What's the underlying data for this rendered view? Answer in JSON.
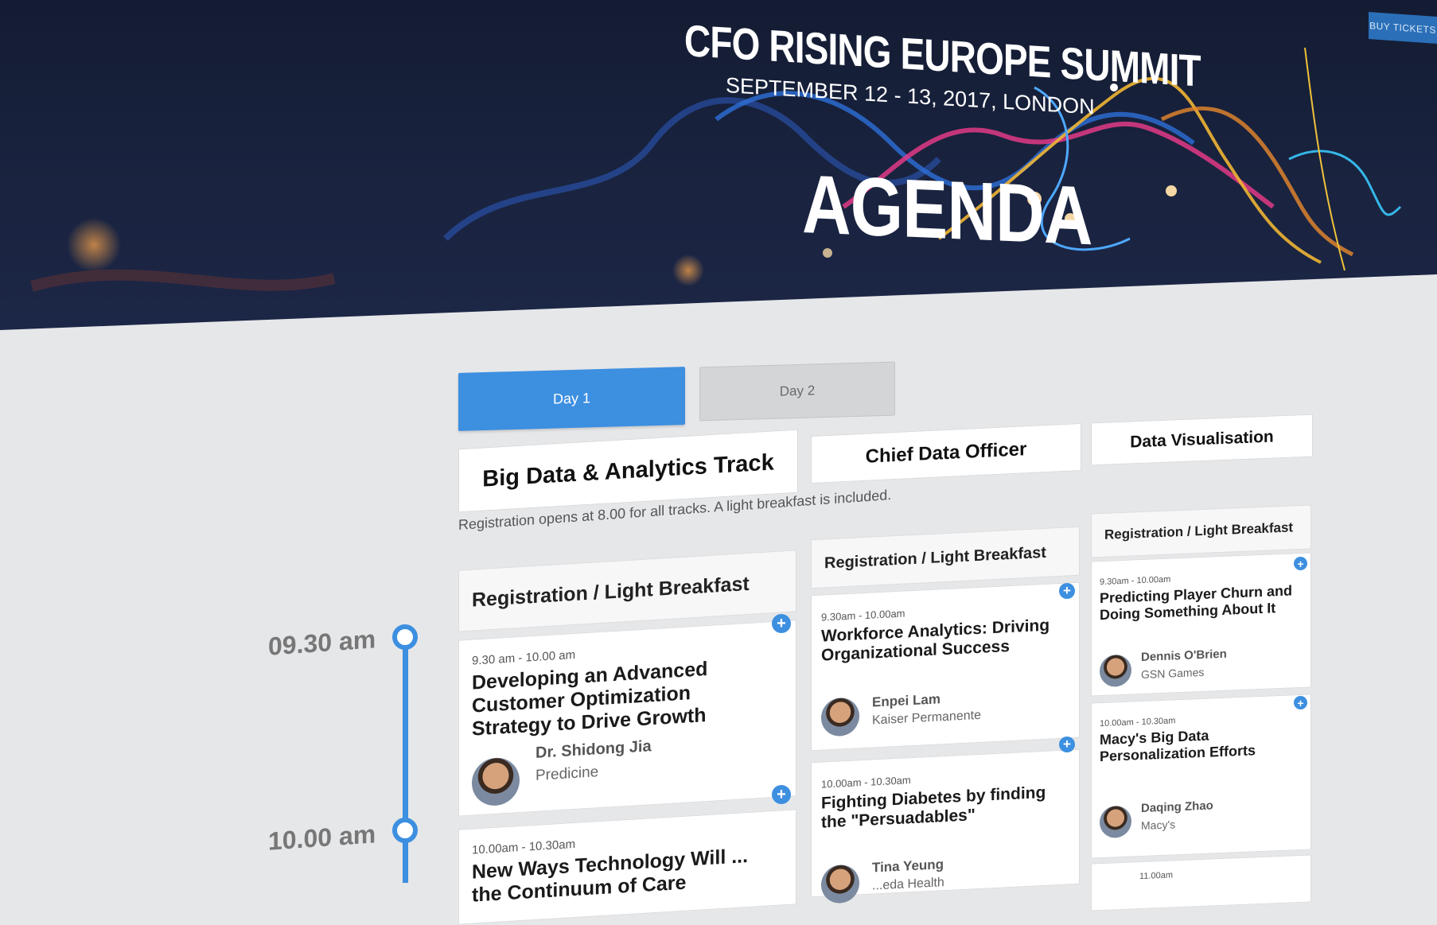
{
  "header": {
    "buy_tickets": "BUY TICKETS",
    "event_title": "CFO RISING EUROPE SUMMIT",
    "event_subtitle": "SEPTEMBER 12 - 13, 2017, LONDON",
    "page_title": "AGENDA"
  },
  "tabs": [
    {
      "label": "Day 1",
      "active": true
    },
    {
      "label": "Day 2",
      "active": false
    }
  ],
  "tracks": [
    {
      "name": "Big Data & Analytics Track"
    },
    {
      "name": "Chief Data Officer"
    },
    {
      "name": "Data Visualisation"
    }
  ],
  "note": "Registration opens at 8.00 for all tracks. A light breakfast is included.",
  "registration_label": "Registration / Light Breakfast",
  "timeline": [
    "09.30 am",
    "10.00 am"
  ],
  "sessions": {
    "col1": [
      {
        "time": "9.30 am - 10.00 am",
        "title": "Developing an Advanced Customer Optimization Strategy to Drive Growth",
        "speaker": "Dr. Shidong Jia",
        "org": "Predicine"
      },
      {
        "time": "10.00am - 10.30am",
        "title": "New Ways Technology Will ... the Continuum of Care"
      }
    ],
    "col2": [
      {
        "time": "9.30am - 10.00am",
        "title": "Workforce Analytics: Driving Organizational Success",
        "speaker": "Enpei Lam",
        "org": "Kaiser Permanente"
      },
      {
        "time": "10.00am - 10.30am",
        "title": "Fighting Diabetes by finding the \"Persuadables\"",
        "speaker": "Tina Yeung",
        "org": "...eda Health"
      }
    ],
    "col3": [
      {
        "time": "9.30am - 10.00am",
        "title": "Predicting Player Churn and Doing Something About It",
        "speaker": "Dennis O'Brien",
        "org": "GSN Games"
      },
      {
        "time": "10.00am - 10.30am",
        "title": "Macy's Big Data Personalization Efforts",
        "speaker": "Daqing Zhao",
        "org": "Macy's"
      },
      {
        "time": "11.00am"
      }
    ]
  },
  "colors": {
    "accent": "#3d8fe0",
    "hero_bg": "#141c33"
  }
}
